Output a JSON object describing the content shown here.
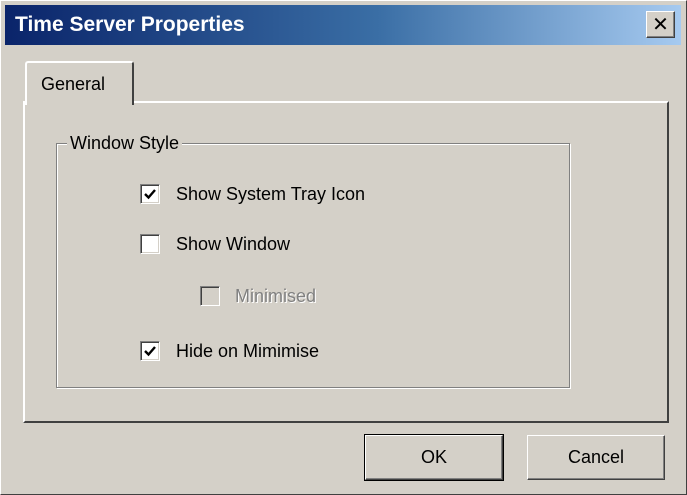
{
  "window": {
    "title": "Time Server Properties",
    "close_glyph": "✕"
  },
  "tabs": [
    {
      "label": "General",
      "selected": true
    }
  ],
  "group": {
    "legend": "Window Style",
    "options": [
      {
        "label": "Show System Tray Icon",
        "checked": true,
        "enabled": true
      },
      {
        "label": "Show Window",
        "checked": false,
        "enabled": true
      },
      {
        "label": "Minimised",
        "checked": false,
        "enabled": false
      },
      {
        "label": "Hide on Mimimise",
        "checked": true,
        "enabled": true
      }
    ]
  },
  "buttons": {
    "ok_label": "OK",
    "cancel_label": "Cancel"
  },
  "colors": {
    "title_start": "#0a246a",
    "title_end": "#a6caf0",
    "face": "#d4d0c8"
  }
}
